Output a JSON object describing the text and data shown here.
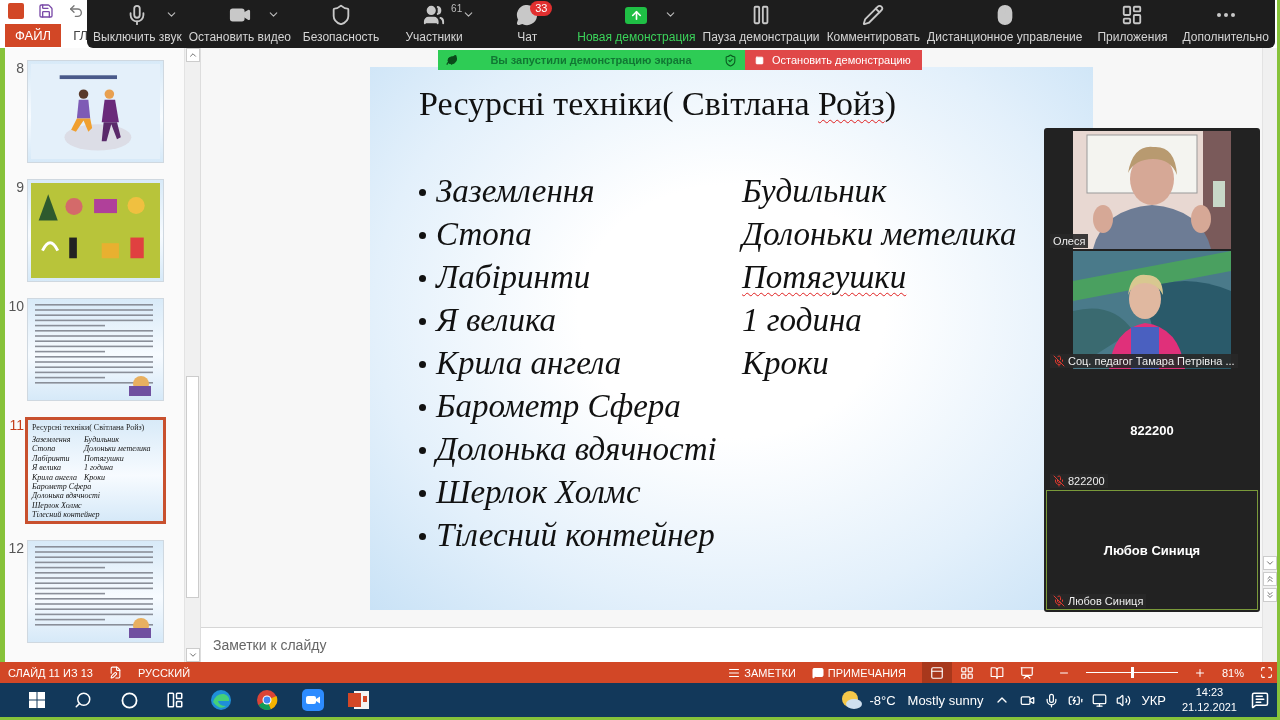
{
  "ribbon": {
    "file_tab": "ФАЙЛ",
    "home_tab": "ГЛ"
  },
  "zoom_toolbar": {
    "items": [
      {
        "kind": "audio",
        "label": "Выключить звук",
        "caret": true
      },
      {
        "kind": "video",
        "label": "Остановить видео",
        "caret": true
      },
      {
        "kind": "security",
        "label": "Безопасность",
        "caret": false
      },
      {
        "kind": "participants",
        "label": "Участники",
        "caret": true,
        "count": "61"
      },
      {
        "kind": "chat",
        "label": "Чат",
        "caret": false,
        "badge": "33"
      },
      {
        "kind": "share",
        "label": "Новая демонстрация",
        "caret": true
      },
      {
        "kind": "pause",
        "label": "Пауза демонстрации",
        "caret": false
      },
      {
        "kind": "annotate",
        "label": "Комментировать",
        "caret": false
      },
      {
        "kind": "remote",
        "label": "Дистанционное управление",
        "caret": false
      },
      {
        "kind": "apps",
        "label": "Приложения",
        "caret": false
      },
      {
        "kind": "more",
        "label": "Дополнительно",
        "caret": false
      }
    ]
  },
  "share_banner": {
    "message": "Вы запустили демонстрацию экрана",
    "stop_button": "Остановить демонстрацию"
  },
  "thumbnails": [
    {
      "number": "8",
      "kind": "jumping",
      "selected": false
    },
    {
      "number": "9",
      "kind": "icons",
      "selected": false
    },
    {
      "number": "10",
      "kind": "text",
      "selected": false
    },
    {
      "number": "11",
      "kind": "list",
      "selected": true,
      "title": "Ресурсні техніки( Світлана Ройз)",
      "rows": [
        {
          "item": "Заземлення",
          "pair": "Будильник"
        },
        {
          "item": "Стопа",
          "pair": "Долоньки метелика"
        },
        {
          "item": "Лабіринти",
          "pair": "Потягушки"
        },
        {
          "item": "Я велика",
          "pair": "1 година"
        },
        {
          "item": "Крила ангела",
          "pair": "Кроки"
        },
        {
          "item": "Барометр Сфера"
        },
        {
          "item": "Долонька вдячності"
        },
        {
          "item": "Шерлок Холмс"
        },
        {
          "item": "Тілесний контейнер"
        }
      ]
    },
    {
      "number": "12",
      "kind": "text",
      "selected": false
    }
  ],
  "slide": {
    "title": [
      {
        "text": "Ресурсні техніки( Світлана ",
        "misspelled": false
      },
      {
        "text": "Ройз",
        "misspelled": true
      },
      {
        "text": ")",
        "misspelled": false
      }
    ],
    "rows": [
      {
        "item": "Заземлення",
        "pair": "Будильник",
        "pair_misspelled": false
      },
      {
        "item": "Стопа",
        "pair": "Долоньки метелика",
        "pair_misspelled": false
      },
      {
        "item": "Лабіринти",
        "pair": "Потягушки",
        "pair_misspelled": true
      },
      {
        "item": "Я велика",
        "pair": "1 година",
        "pair_misspelled": false
      },
      {
        "item": "Крила ангела",
        "pair": "Кроки",
        "pair_misspelled": false
      },
      {
        "item": "Барометр Сфера"
      },
      {
        "item": "Долонька вдячності"
      },
      {
        "item": "Шерлок Холмс"
      },
      {
        "item": "Тілесний контейнер"
      }
    ]
  },
  "notes": {
    "placeholder": "Заметки к слайду"
  },
  "video_panel": {
    "tiles": [
      {
        "kind": "video",
        "name": "Олеся",
        "muted": false,
        "active": false
      },
      {
        "kind": "video",
        "name": "Соц. педагог Тамара Петрівна ...",
        "muted": true,
        "active": false
      },
      {
        "kind": "avatar",
        "display": "822200",
        "name": "822200",
        "muted": true,
        "active": false
      },
      {
        "kind": "avatar",
        "display": "Любов Синиця",
        "name": "Любов Синиця",
        "muted": true,
        "active": true
      }
    ]
  },
  "status_bar": {
    "slide_counter": "СЛАЙД 11 ИЗ 13",
    "language": "РУССКИЙ",
    "notes": "ЗАМЕТКИ",
    "comments": "ПРИМЕЧАНИЯ",
    "views": [
      {
        "kind": "normal",
        "selected": true
      },
      {
        "kind": "sorter",
        "selected": false
      },
      {
        "kind": "reading",
        "selected": false
      },
      {
        "kind": "slideshow",
        "selected": false
      }
    ],
    "zoom": {
      "level": 0.5,
      "reading": "81%"
    }
  },
  "taskbar": {
    "temperature": "-8°C",
    "weather": "Mostly sunny",
    "language": "УКР",
    "time": "14:23",
    "date": "21.12.2021"
  }
}
